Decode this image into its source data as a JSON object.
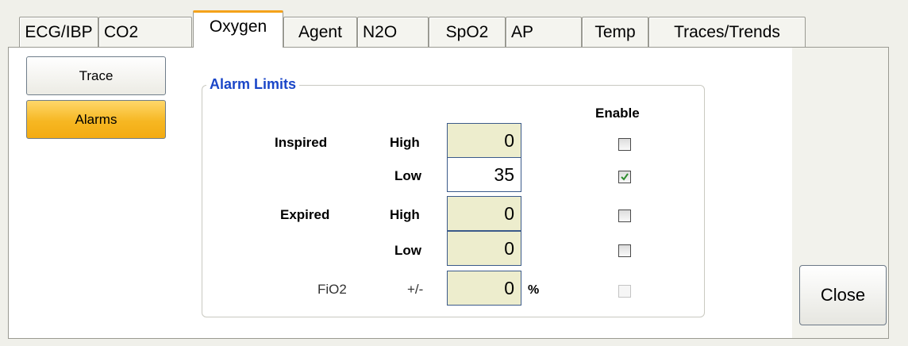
{
  "tabs": [
    {
      "label": "ECG/IBP"
    },
    {
      "label": "CO2"
    },
    {
      "label": "Oxygen"
    },
    {
      "label": "Agent"
    },
    {
      "label": "N2O"
    },
    {
      "label": "SpO2"
    },
    {
      "label": "AP"
    },
    {
      "label": "Temp"
    },
    {
      "label": "Traces/Trends"
    }
  ],
  "active_tab": "Oxygen",
  "side_buttons": {
    "trace": "Trace",
    "alarms": "Alarms",
    "selected": "Alarms"
  },
  "alarm_limits": {
    "title": "Alarm Limits",
    "enable_header": "Enable",
    "inspired": {
      "label": "Inspired",
      "high_label": "High",
      "high_value": "0",
      "high_enabled": false,
      "low_label": "Low",
      "low_value": "35",
      "low_enabled": true
    },
    "expired": {
      "label": "Expired",
      "high_label": "High",
      "high_value": "0",
      "high_enabled": false,
      "low_label": "Low",
      "low_value": "0",
      "low_enabled": false
    },
    "fio2": {
      "label": "FiO2",
      "tolerance_label": "+/-",
      "value": "0",
      "unit": "%",
      "enabled": false,
      "checkbox_disabled": true
    }
  },
  "close_label": "Close",
  "colors": {
    "active_tab_accent": "#f4a21a",
    "selected_button": "#f6b722",
    "group_title": "#1a46c8",
    "field_background": "#ededcd",
    "check_mark": "#2e8b2e"
  }
}
